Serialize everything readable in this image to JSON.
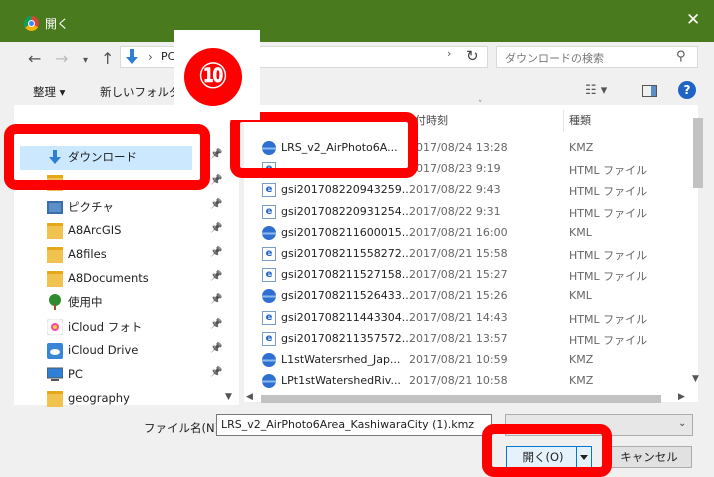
{
  "window": {
    "title": "開く",
    "close": "✕"
  },
  "address": {
    "segment": "PC",
    "separator": "›"
  },
  "search": {
    "placeholder": "ダウンロードの検索"
  },
  "toolbar": {
    "organize": "整理 ▾",
    "new_folder": "新しいフォルダー"
  },
  "columns": {
    "date": "付時刻",
    "type": "種類"
  },
  "nav_items": [
    {
      "label": "ダウンロード",
      "pinned": true
    },
    {
      "label": "",
      "pinned": true
    },
    {
      "label": "ピクチャ",
      "pinned": true
    },
    {
      "label": "A8ArcGIS",
      "pinned": true
    },
    {
      "label": "A8files",
      "pinned": true
    },
    {
      "label": "A8Documents",
      "pinned": true
    },
    {
      "label": "使用中",
      "pinned": true
    },
    {
      "label": "iCloud フォト",
      "pinned": true
    },
    {
      "label": "iCloud Drive",
      "pinned": true
    },
    {
      "label": "PC",
      "pinned": true
    },
    {
      "label": "geography",
      "pinned": false
    }
  ],
  "files": [
    {
      "name": "LRS_v2_AirPhoto6A...",
      "date": "2017/08/24 13:28",
      "type": "KMZ",
      "icon": "kmz"
    },
    {
      "name": "",
      "date": "2017/08/23 9:19",
      "type": "HTML ファイル",
      "icon": "html"
    },
    {
      "name": "gsi201708220943259...",
      "date": "2017/08/22 9:43",
      "type": "HTML ファイル",
      "icon": "html"
    },
    {
      "name": "gsi201708220931254...",
      "date": "2017/08/22 9:31",
      "type": "HTML ファイル",
      "icon": "html"
    },
    {
      "name": "gsi201708211600015...",
      "date": "2017/08/21 16:00",
      "type": "KML",
      "icon": "kmz"
    },
    {
      "name": "gsi201708211558272...",
      "date": "2017/08/21 15:58",
      "type": "HTML ファイル",
      "icon": "html"
    },
    {
      "name": "gsi201708211527158...",
      "date": "2017/08/21 15:27",
      "type": "HTML ファイル",
      "icon": "html"
    },
    {
      "name": "gsi201708211526433...",
      "date": "2017/08/21 15:26",
      "type": "KML",
      "icon": "kmz"
    },
    {
      "name": "gsi201708211443304...",
      "date": "2017/08/21 14:43",
      "type": "HTML ファイル",
      "icon": "html"
    },
    {
      "name": "gsi201708211357572...",
      "date": "2017/08/21 13:57",
      "type": "HTML ファイル",
      "icon": "html"
    },
    {
      "name": "L1stWatersrhed_Jap...",
      "date": "2017/08/21 10:59",
      "type": "KMZ",
      "icon": "kmz"
    },
    {
      "name": "LPt1stWatershedRiv...",
      "date": "2017/08/21 10:58",
      "type": "KMZ",
      "icon": "kmz"
    }
  ],
  "filename": {
    "label": "ファイル名(N):",
    "value": "LRS_v2_AirPhoto6Area_KashiwaraCity (1).kmz"
  },
  "buttons": {
    "open": "開く(O)",
    "cancel": "キャンセル"
  },
  "annotation": {
    "badge": "⑩",
    "color": "#ff0000"
  }
}
